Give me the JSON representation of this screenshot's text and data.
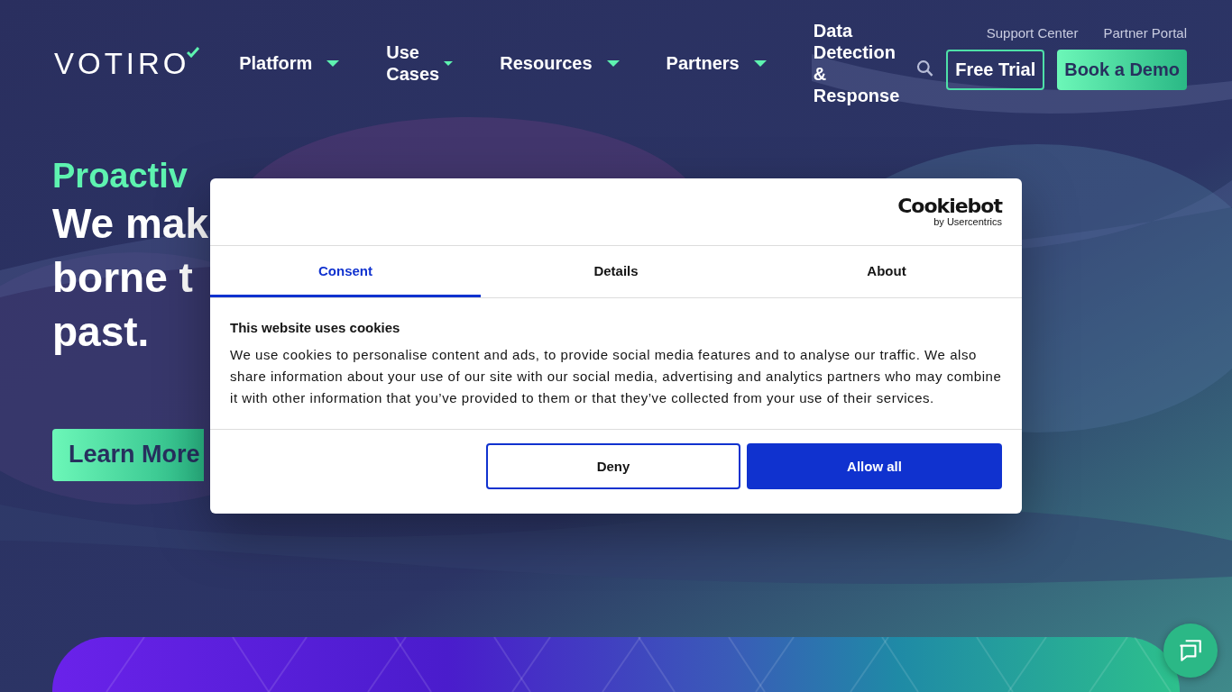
{
  "header": {
    "logo": "VOTIRO",
    "nav": [
      {
        "label": "Platform",
        "has_menu": true
      },
      {
        "label": "Use Cases",
        "has_menu": true
      },
      {
        "label": "Resources",
        "has_menu": true
      },
      {
        "label": "Partners",
        "has_menu": true
      },
      {
        "label": "Data Detection & Response",
        "has_menu": false
      }
    ],
    "top_links": [
      "Support Center",
      "Partner Portal"
    ],
    "free_trial": "Free Trial",
    "book_demo": "Book a Demo"
  },
  "hero": {
    "eyebrow": "Proactiv",
    "lines": [
      "We mak",
      "borne t",
      "past."
    ],
    "button": "Learn More"
  },
  "cookie_dialog": {
    "brand": "Cookiebot",
    "brand_sub": "by Usercentrics",
    "tabs": [
      {
        "label": "Consent",
        "selected": true
      },
      {
        "label": "Details",
        "selected": false
      },
      {
        "label": "About",
        "selected": false
      }
    ],
    "title": "This website uses cookies",
    "body": "We use cookies to personalise content and ads, to provide social media features and to analyse our traffic. We also share information about your use of our site with our social media, advertising and analytics partners who may combine it with other information that you’ve provided to them or that they’ve collected from your use of their services.",
    "deny": "Deny",
    "allow": "Allow all"
  }
}
